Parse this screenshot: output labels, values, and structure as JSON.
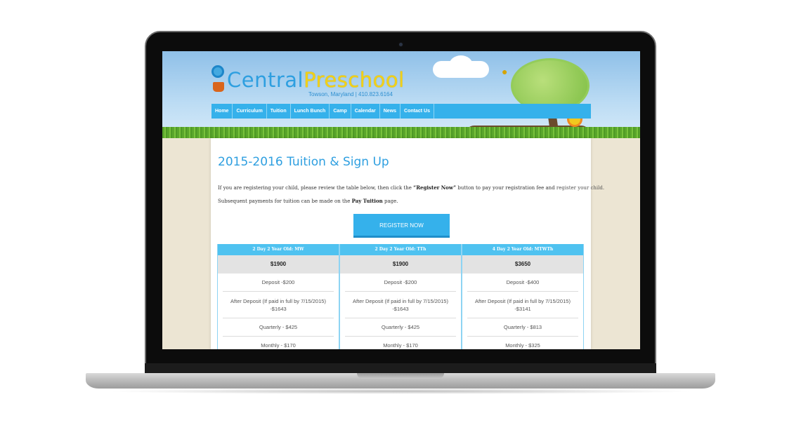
{
  "site": {
    "logo_part1": "Central",
    "logo_part2": "Preschool",
    "tagline": "Towson, Maryland | 410.823.6164"
  },
  "nav": [
    "Home",
    "Curriculum",
    "Tuition",
    "Lunch Bunch",
    "Camp",
    "Calendar",
    "News",
    "Contact Us"
  ],
  "page": {
    "title": "2015-2016 Tuition & Sign Up",
    "intro_pre": "If you are registering your child, please review the table below, then click the ",
    "intro_bold": "“Register Now”",
    "intro_mid": " button to pay your registration fee and ",
    "intro_link": "register your child.",
    "payments_pre": "Subsequent payments for tuition can be made on the ",
    "payments_bold": "Pay Tuition",
    "payments_post": " page.",
    "register_button": "REGISTER NOW"
  },
  "table": {
    "columns": [
      {
        "header": "2 Day 2 Year Old: MW",
        "price": "$1900",
        "rows": [
          "Deposit -$200",
          "After Deposit (If paid in full by 7/15/2015)",
          "-$1643",
          "Quarterly - $425",
          "Monthly - $170"
        ]
      },
      {
        "header": "2 Day 2 Year Old: TTh",
        "price": "$1900",
        "rows": [
          "Deposit -$200",
          "After Deposit (If paid in full by 7/15/2015)",
          "-$1643",
          "Quarterly - $425",
          "Monthly - $170"
        ]
      },
      {
        "header": "4 Day 2 Year Old: MTWTh",
        "price": "$3650",
        "rows": [
          "Deposit -$400",
          "After Deposit (If paid in full by 7/15/2015)",
          "-$3141",
          "Quarterly - $813",
          "Monthly - $325"
        ]
      }
    ]
  },
  "colors": {
    "accent": "#35b1eb",
    "logo_blue": "#2e9fe0",
    "logo_yellow": "#f2d117"
  }
}
